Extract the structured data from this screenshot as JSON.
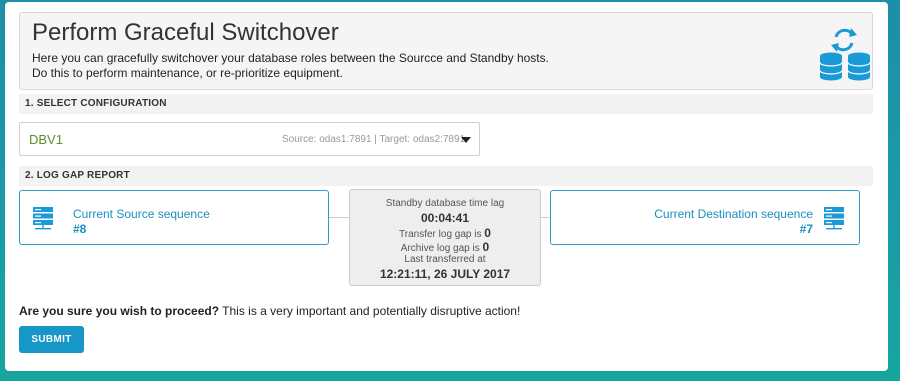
{
  "header": {
    "title": "Perform Graceful Switchover",
    "description_line1": "Here you can gracefully switchover your database roles between the Sourcce and Standby hosts.",
    "description_line2": "Do this to perform maintenance, or re-prioritize equipment.",
    "icon": "database-switch-icon"
  },
  "select_configuration": {
    "section_title": "1. SELECT CONFIGURATION",
    "selected_value": "DBV1",
    "meta": "Source: odas1:7891 | Target: odas2:7891"
  },
  "log_gap_report": {
    "section_title": "2. LOG GAP REPORT",
    "source": {
      "label": "Current Source sequence",
      "sequence": "#8",
      "icon": "server-icon"
    },
    "destination": {
      "label": "Current Destination sequence",
      "sequence": "#7",
      "icon": "server-icon"
    },
    "lag": {
      "title": "Standby database time lag",
      "time_lag": "00:04:41",
      "transfer_gap_label": "Transfer log gap is",
      "transfer_gap_value": "0",
      "archive_gap_label": "Archive log gap is",
      "archive_gap_value": "0",
      "last_transferred_label": "Last transferred at",
      "last_transferred_value": "12:21:11, 26 JULY 2017"
    }
  },
  "confirm": {
    "question": "Are you sure you wish to proceed?",
    "warning": " This is a very important and potentially disruptive action!"
  },
  "submit_label": "SUBMIT",
  "colors": {
    "accent": "#1797c8",
    "selected_value": "#5a8f2c",
    "background_teal": "#1a9aa8"
  }
}
